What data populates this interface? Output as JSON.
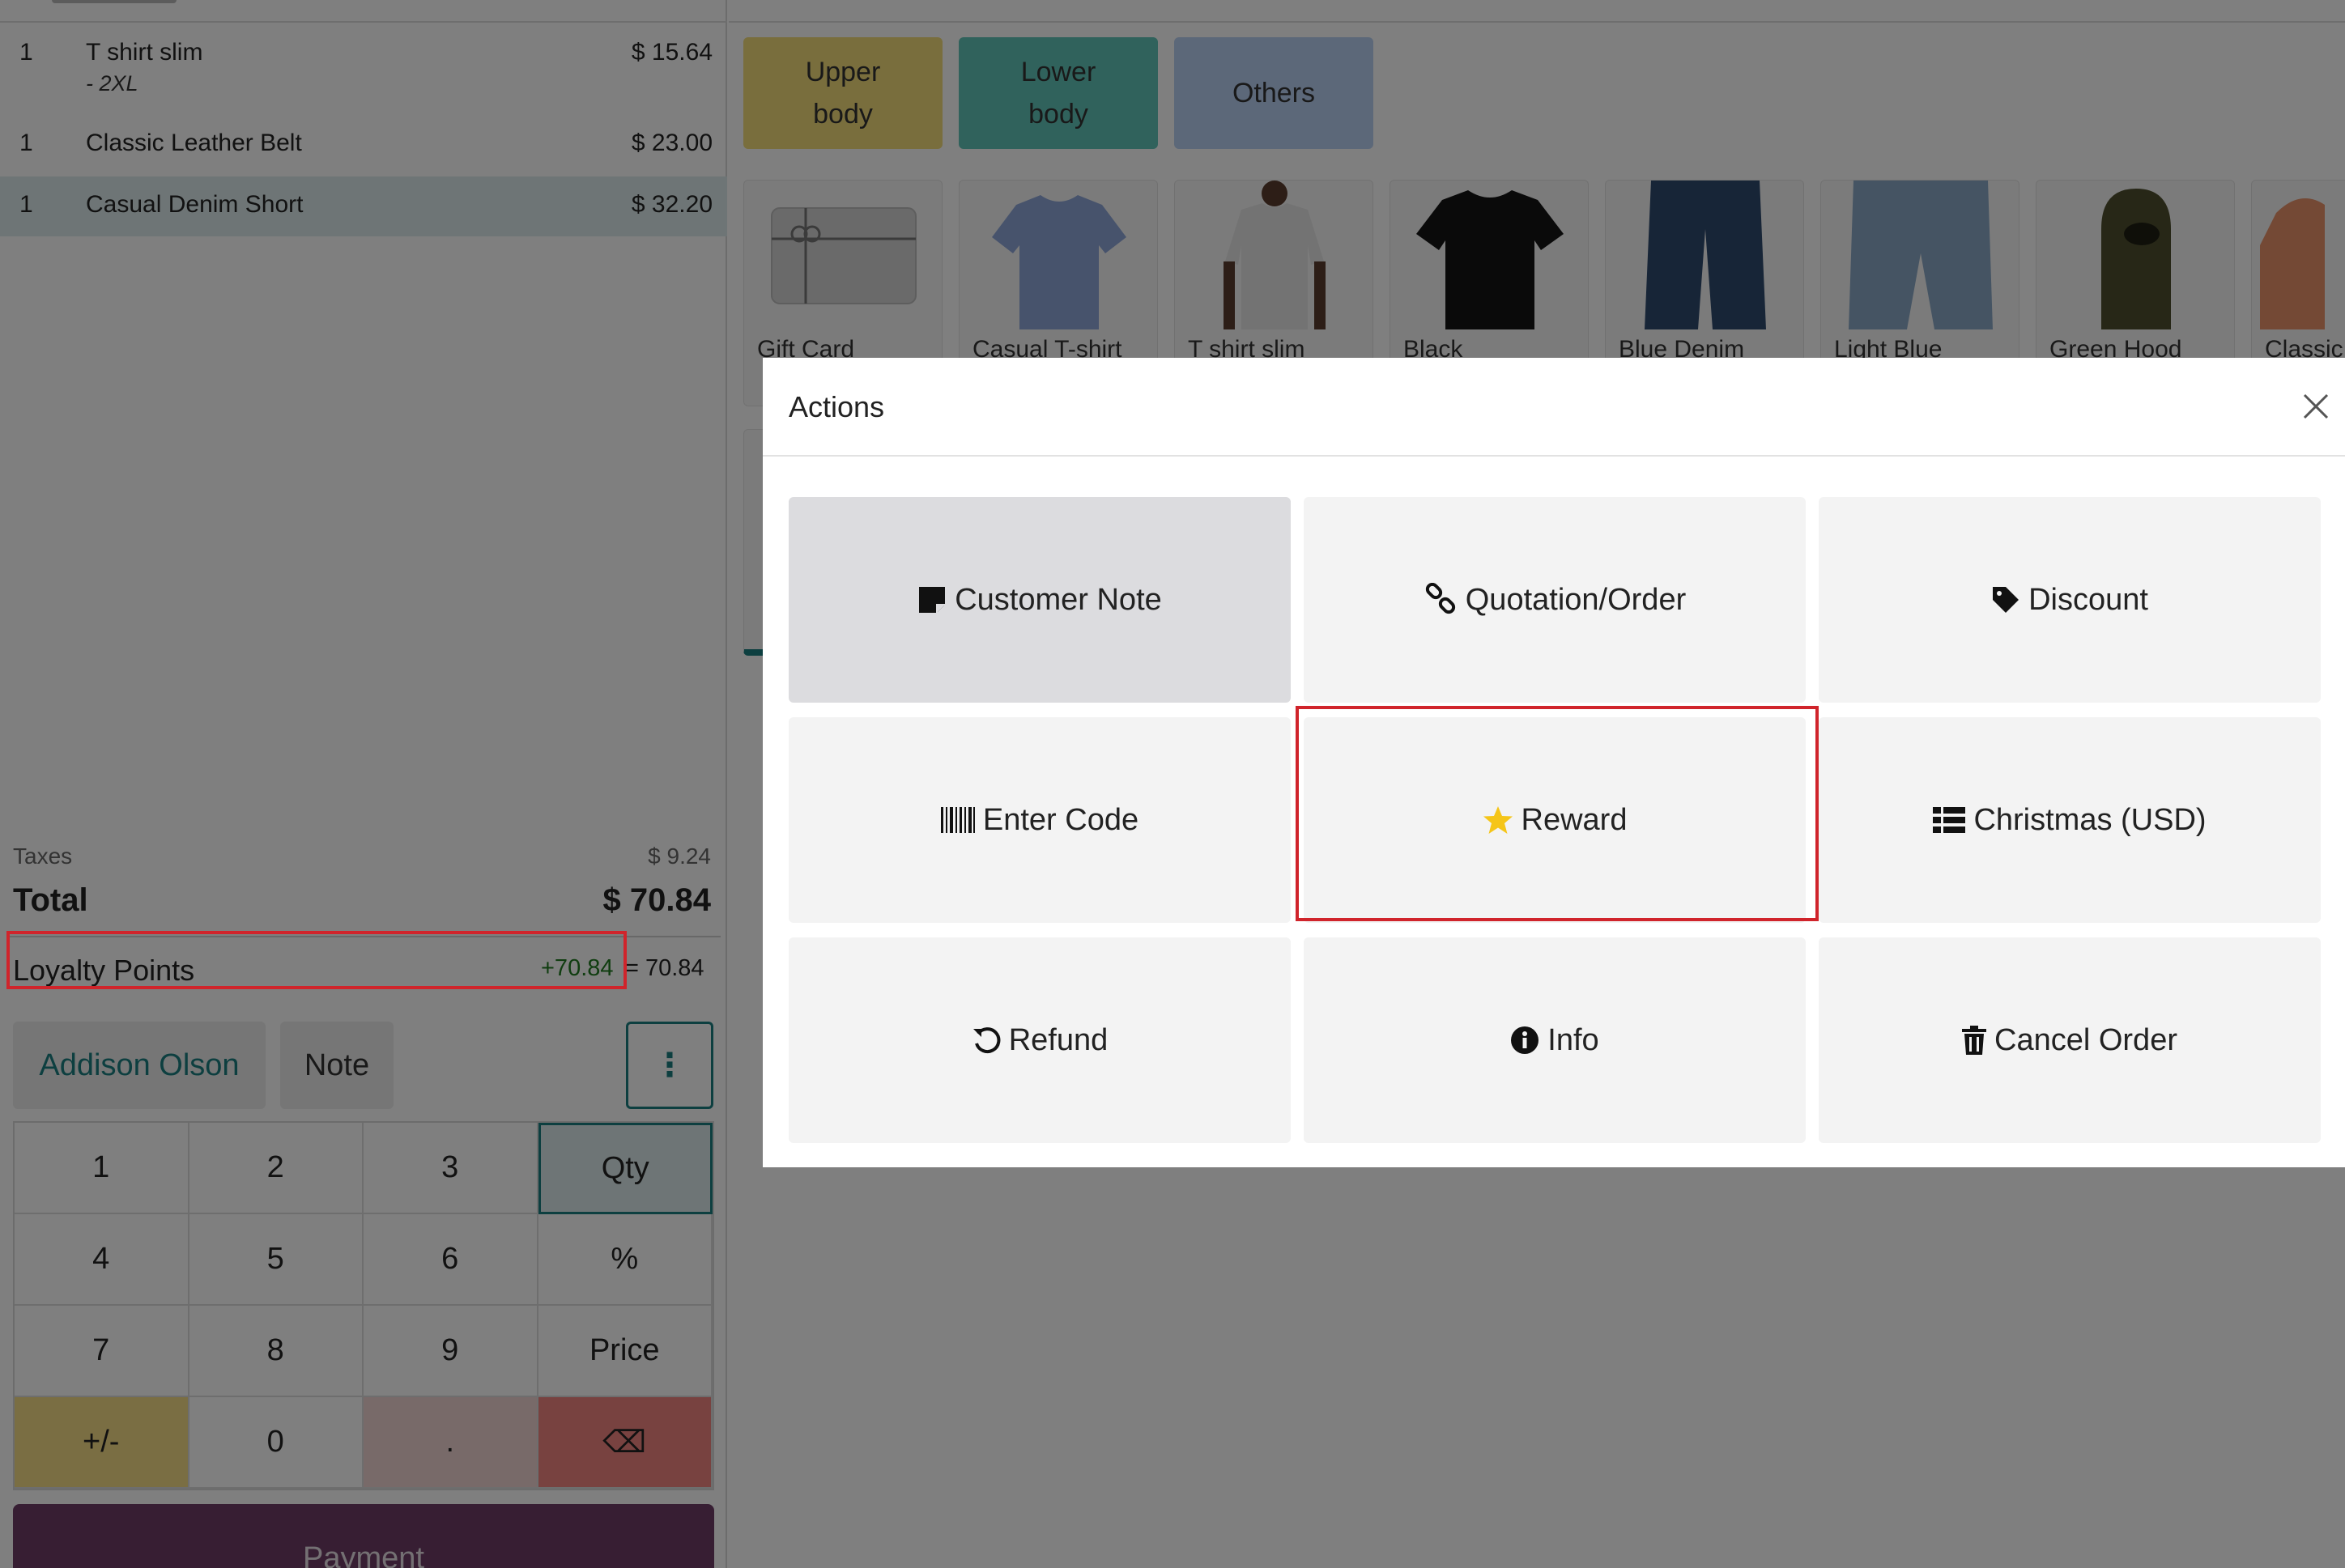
{
  "order": {
    "lines": [
      {
        "qty": "1",
        "name": "T shirt slim",
        "attr": "- 2XL",
        "price": "$ 15.64"
      },
      {
        "qty": "1",
        "name": "Classic Leather Belt",
        "attr": "",
        "price": "$ 23.00"
      },
      {
        "qty": "1",
        "name": "Casual Denim Short",
        "attr": "",
        "price": "$ 32.20"
      }
    ],
    "taxes_label": "Taxes",
    "taxes_value": "$ 9.24",
    "total_label": "Total",
    "total_value": "$ 70.84",
    "loyalty_label": "Loyalty Points",
    "loyalty_delta": "+70.84",
    "loyalty_total": "= 70.84"
  },
  "controls": {
    "customer": "Addison Olson",
    "note": "Note",
    "more": "⋮"
  },
  "numpad": {
    "k1": "1",
    "k2": "2",
    "k3": "3",
    "qty": "Qty",
    "k4": "4",
    "k5": "5",
    "k6": "6",
    "pct": "%",
    "k7": "7",
    "k8": "8",
    "k9": "9",
    "price": "Price",
    "pm": "+/-",
    "k0": "0",
    "dot": ".",
    "bs": "⌫"
  },
  "payment_label": "Payment",
  "categories": {
    "upper": "Upper body",
    "lower": "Lower body",
    "others": "Others"
  },
  "products": [
    {
      "name": "Gift Card"
    },
    {
      "name": "Casual T-shirt"
    },
    {
      "name": "T shirt slim"
    },
    {
      "name": "Black"
    },
    {
      "name": "Blue Denim"
    },
    {
      "name": "Light Blue"
    },
    {
      "name": "Green Hood"
    },
    {
      "name": "Classic"
    }
  ],
  "dialog": {
    "title": "Actions",
    "actions": {
      "customer_note": "Customer Note",
      "quotation": "Quotation/Order",
      "discount": "Discount",
      "enter_code": "Enter Code",
      "reward": "Reward",
      "pricelist": "Christmas (USD)",
      "refund": "Refund",
      "info": "Info",
      "cancel": "Cancel Order"
    }
  },
  "colors": {
    "accent": "#1b7e81",
    "highlight": "#d0242b",
    "payment": "#6f3d67",
    "star": "#f5c518"
  }
}
